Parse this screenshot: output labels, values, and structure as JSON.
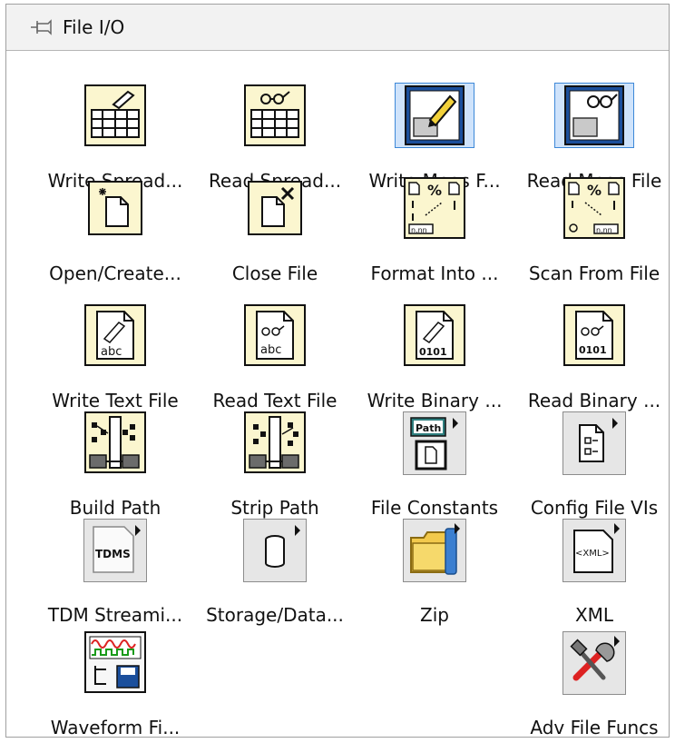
{
  "palette": {
    "title": "File I/O",
    "pin_icon": "pushpin-icon",
    "items": [
      {
        "label": "Write Spread...",
        "icon": "write-spreadsheet-icon"
      },
      {
        "label": "Read Spread...",
        "icon": "read-spreadsheet-icon"
      },
      {
        "label": "Write Meas F...",
        "icon": "write-measurement-file-icon",
        "selected": true
      },
      {
        "label": "Read Meas File",
        "icon": "read-measurement-file-icon",
        "selected": true
      },
      {
        "label": "Open/Create...",
        "icon": "open-create-file-icon"
      },
      {
        "label": "Close File",
        "icon": "close-file-icon"
      },
      {
        "label": "Format Into ...",
        "icon": "format-into-file-icon"
      },
      {
        "label": "Scan From File",
        "icon": "scan-from-file-icon"
      },
      {
        "label": "Write Text File",
        "icon": "write-text-file-icon"
      },
      {
        "label": "Read Text File",
        "icon": "read-text-file-icon"
      },
      {
        "label": "Write Binary ...",
        "icon": "write-binary-file-icon"
      },
      {
        "label": "Read Binary ...",
        "icon": "read-binary-file-icon"
      },
      {
        "label": "Build Path",
        "icon": "build-path-icon"
      },
      {
        "label": "Strip Path",
        "icon": "strip-path-icon"
      },
      {
        "label": "File Constants",
        "icon": "file-constants-icon",
        "submenu": true,
        "badge": "Path"
      },
      {
        "label": "Config File VIs",
        "icon": "config-file-icon",
        "submenu": true
      },
      {
        "label": "TDM Streami...",
        "icon": "tdms-icon",
        "submenu": true,
        "badge": "TDMS"
      },
      {
        "label": "Storage/Data...",
        "icon": "storage-database-icon",
        "submenu": true
      },
      {
        "label": "Zip",
        "icon": "zip-folder-icon",
        "submenu": true
      },
      {
        "label": "XML",
        "icon": "xml-icon",
        "submenu": true,
        "badge": "<XML>"
      },
      {
        "label": "Waveform Fi...",
        "icon": "waveform-file-icon"
      },
      {
        "label": "Adv File Funcs",
        "icon": "advanced-file-functions-icon",
        "submenu": true
      }
    ]
  }
}
